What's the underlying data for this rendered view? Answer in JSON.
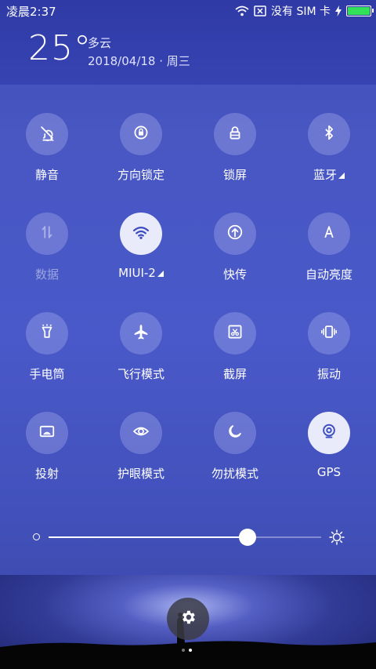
{
  "status_bar": {
    "time": "凌晨2:37",
    "carrier": "没有 SIM 卡",
    "battery_level": 1.0,
    "battery_color": "#33e05a"
  },
  "weather": {
    "temperature": "25°",
    "condition": "多云",
    "date": "2018/04/18 · 周三"
  },
  "tiles": [
    {
      "label": "静音",
      "icon": "bell-off-icon",
      "state": "off"
    },
    {
      "label": "方向锁定",
      "icon": "rotation-lock-icon",
      "state": "off"
    },
    {
      "label": "锁屏",
      "icon": "lock-icon",
      "state": "off"
    },
    {
      "label": "蓝牙",
      "icon": "bluetooth-icon",
      "state": "off",
      "has_menu": true
    },
    {
      "label": "数据",
      "icon": "mobile-data-icon",
      "state": "disabled"
    },
    {
      "label": "MIUI-2",
      "icon": "wifi-icon",
      "state": "on",
      "has_menu": true
    },
    {
      "label": "快传",
      "icon": "quick-transfer-icon",
      "state": "off"
    },
    {
      "label": "自动亮度",
      "icon": "auto-brightness-icon",
      "state": "off"
    },
    {
      "label": "手电筒",
      "icon": "flashlight-icon",
      "state": "off"
    },
    {
      "label": "飞行模式",
      "icon": "airplane-icon",
      "state": "off"
    },
    {
      "label": "截屏",
      "icon": "screenshot-icon",
      "state": "off"
    },
    {
      "label": "振动",
      "icon": "vibrate-icon",
      "state": "off"
    },
    {
      "label": "投射",
      "icon": "cast-icon",
      "state": "off"
    },
    {
      "label": "护眼模式",
      "icon": "eye-icon",
      "state": "off"
    },
    {
      "label": "勿扰模式",
      "icon": "moon-icon",
      "state": "off"
    },
    {
      "label": "GPS",
      "icon": "gps-icon",
      "state": "on"
    }
  ],
  "brightness": {
    "level": 0.73
  },
  "pager": {
    "pages": 2,
    "current": 2
  },
  "colors": {
    "accent_on": "#e9ebfb",
    "icon_on": "#3d4cc0"
  }
}
